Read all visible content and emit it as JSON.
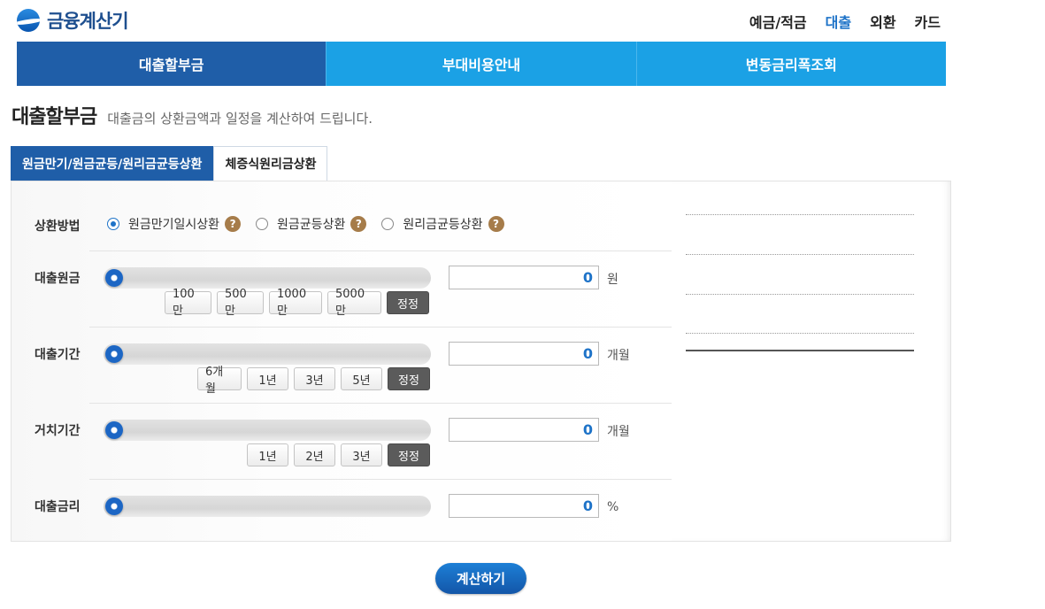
{
  "header": {
    "logo_text": "금융계산기",
    "nav": [
      {
        "label": "예금/적금",
        "active": false
      },
      {
        "label": "대출",
        "active": true
      },
      {
        "label": "외환",
        "active": false
      },
      {
        "label": "카드",
        "active": false
      }
    ]
  },
  "main_tabs": [
    {
      "label": "대출할부금",
      "active": true
    },
    {
      "label": "부대비용안내",
      "active": false
    },
    {
      "label": "변동금리폭조회",
      "active": false
    }
  ],
  "page": {
    "title": "대출할부금",
    "description": "대출금의 상환금액과 일정을 계산하여 드립니다."
  },
  "sub_tabs": [
    {
      "label": "원금만기/원금균등/원리금균등상환",
      "active": true
    },
    {
      "label": "체증식원리금상환",
      "active": false
    }
  ],
  "form": {
    "repayment": {
      "label": "상환방법",
      "options": [
        {
          "label": "원금만기일시상환",
          "checked": true
        },
        {
          "label": "원금균등상환",
          "checked": false
        },
        {
          "label": "원리금균등상환",
          "checked": false
        }
      ],
      "help_glyph": "?"
    },
    "principal": {
      "label": "대출원금",
      "value": "0",
      "unit": "원",
      "slider_level": 0,
      "buttons": [
        "100만",
        "500만",
        "1000만",
        "5000만"
      ],
      "reset": "정정"
    },
    "period": {
      "label": "대출기간",
      "value": "0",
      "unit": "개월",
      "slider_level": 0,
      "buttons": [
        "6개월",
        "1년",
        "3년",
        "5년"
      ],
      "reset": "정정"
    },
    "grace": {
      "label": "거치기간",
      "value": "0",
      "unit": "개월",
      "slider_level": 0,
      "buttons": [
        "1년",
        "2년",
        "3년"
      ],
      "reset": "정정"
    },
    "rate": {
      "label": "대출금리",
      "value": "0",
      "unit": "%",
      "slider_level": 0
    }
  },
  "calc_button": "계산하기",
  "colors": {
    "primary_dark": "#1f5ea8",
    "primary_light": "#1ba1e5",
    "accent_value": "#1e73c8",
    "help_icon": "#a67c4a"
  }
}
